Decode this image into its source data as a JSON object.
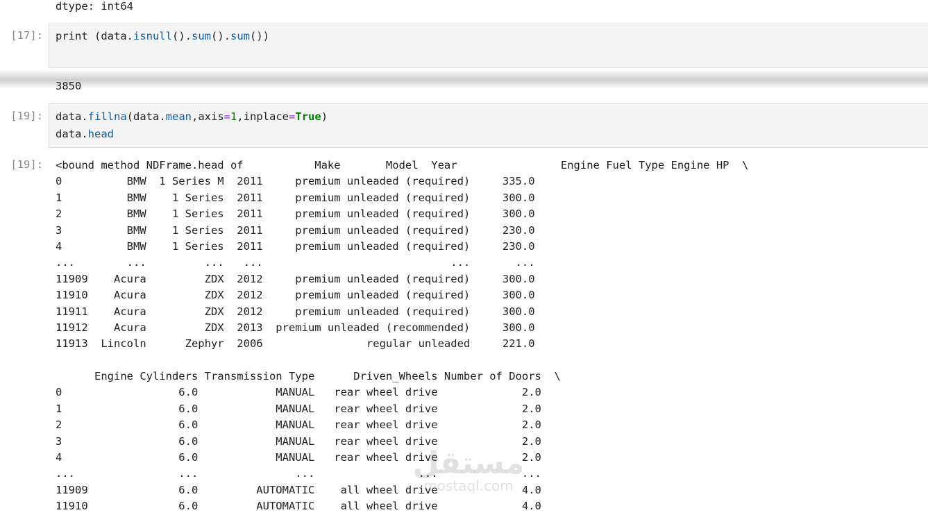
{
  "top_output": "dtype: int64",
  "cell17": {
    "prompt": "[17]:",
    "code": [
      "print (data.",
      "isnull",
      "().",
      "sum",
      "().",
      "sum",
      "())"
    ],
    "output": "3850"
  },
  "cell19": {
    "prompt_in": "[19]:",
    "prompt_out": "[19]:",
    "code_line1": [
      "data.",
      "fillna",
      "(data.",
      "mean",
      ",axis",
      "=",
      "1",
      ",inplace",
      "=",
      "True",
      ")"
    ],
    "code_line2": [
      "data.",
      "head"
    ],
    "output_block1": "<bound method NDFrame.head of           Make       Model  Year                Engine Fuel Type Engine HP  \\\n0          BMW  1 Series M  2011     premium unleaded (required)     335.0\n1          BMW    1 Series  2011     premium unleaded (required)     300.0\n2          BMW    1 Series  2011     premium unleaded (required)     300.0\n3          BMW    1 Series  2011     premium unleaded (required)     230.0\n4          BMW    1 Series  2011     premium unleaded (required)     230.0\n...        ...         ...   ...                             ...       ...\n11909    Acura         ZDX  2012     premium unleaded (required)     300.0\n11910    Acura         ZDX  2012     premium unleaded (required)     300.0\n11911    Acura         ZDX  2012     premium unleaded (required)     300.0\n11912    Acura         ZDX  2013  premium unleaded (recommended)     300.0\n11913  Lincoln      Zephyr  2006                regular unleaded     221.0",
    "output_block2": "      Engine Cylinders Transmission Type      Driven_Wheels Number of Doors  \\\n0                  6.0            MANUAL   rear wheel drive             2.0\n1                  6.0            MANUAL   rear wheel drive             2.0\n2                  6.0            MANUAL   rear wheel drive             2.0\n3                  6.0            MANUAL   rear wheel drive             2.0\n4                  6.0            MANUAL   rear wheel drive             2.0\n...                ...               ...                ...             ...\n11909              6.0         AUTOMATIC    all wheel drive             4.0\n11910              6.0         AUTOMATIC    all wheel drive             4.0"
  },
  "watermark": {
    "arabic": "مستقل",
    "latin": "mostaql.com"
  },
  "colors": {
    "prompt": "#8a8a8a",
    "cell_bg": "#f5f5f5",
    "builtin_blue": "#0f5aa8",
    "keyword_green": "#008000",
    "operator_purple": "#aa22ff"
  }
}
